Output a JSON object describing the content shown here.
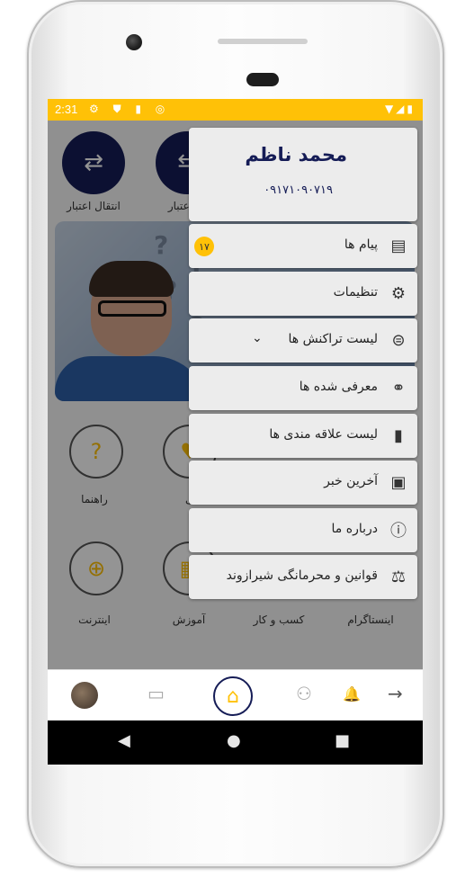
{
  "status_bar": {
    "time": "2:31",
    "left_icons": "⚙ ⛊ ▮ ◎",
    "right_icons": "▼◢▮"
  },
  "app": {
    "quick_actions": [
      {
        "label": "انتقال اعتبار",
        "icon": "transfer-icon"
      },
      {
        "label": "ت اعتبار",
        "icon": "credit-icon"
      }
    ],
    "grid": [
      {
        "label": "راهنما",
        "icon": "help-icon"
      },
      {
        "label": "متی",
        "icon": "charity-icon"
      },
      {
        "label": "اینترنت",
        "icon": "internet-icon"
      },
      {
        "label": "آموزش",
        "icon": "education-icon"
      },
      {
        "label": "کسب و کار",
        "icon": "business-icon"
      },
      {
        "label": "اینستاگرام",
        "icon": "instagram-icon"
      }
    ]
  },
  "drawer": {
    "profile": {
      "name": "محمد ناظم",
      "phone": "۰۹۱۷۱۰۹۰۷۱۹"
    },
    "items": [
      {
        "label": "پیام ها",
        "icon": "messages-icon",
        "badge": "۱۷"
      },
      {
        "label": "تنظیمات",
        "icon": "settings-icon"
      },
      {
        "label": "لیست تراکنش ها",
        "icon": "transactions-icon",
        "expandable": true
      },
      {
        "label": "معرفی شده ها",
        "icon": "referrals-icon"
      },
      {
        "label": "لیست علاقه مندی ها",
        "icon": "bookmark-icon"
      },
      {
        "label": "آخرین خبر",
        "icon": "news-icon"
      },
      {
        "label": "درباره ما",
        "icon": "info-icon"
      },
      {
        "label": "قوانین و محرمانگی شیرازوند",
        "icon": "scales-icon"
      }
    ]
  },
  "colors": {
    "accent": "#ffc107",
    "navy": "#151c56",
    "drawer_item": "#ececec"
  }
}
